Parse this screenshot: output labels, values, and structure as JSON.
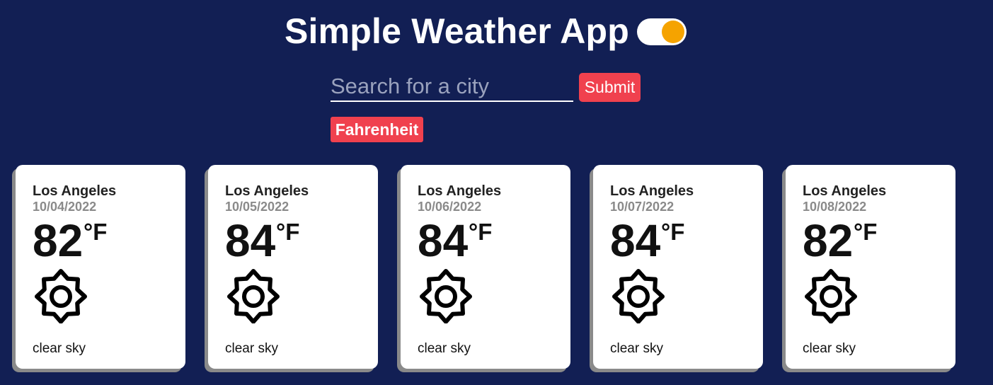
{
  "header": {
    "title": "Simple Weather App"
  },
  "search": {
    "placeholder": "Search for a city",
    "value": "",
    "submit_label": "Submit"
  },
  "units": {
    "button_label": "Fahrenheit"
  },
  "colors": {
    "background": "#121f54",
    "accent": "#f0414e",
    "toggle_knob": "#f5a300"
  },
  "forecast": [
    {
      "city": "Los Angeles",
      "date": "10/04/2022",
      "temp": "82",
      "unit": "°F",
      "icon": "sun-icon",
      "description": "clear sky"
    },
    {
      "city": "Los Angeles",
      "date": "10/05/2022",
      "temp": "84",
      "unit": "°F",
      "icon": "sun-icon",
      "description": "clear sky"
    },
    {
      "city": "Los Angeles",
      "date": "10/06/2022",
      "temp": "84",
      "unit": "°F",
      "icon": "sun-icon",
      "description": "clear sky"
    },
    {
      "city": "Los Angeles",
      "date": "10/07/2022",
      "temp": "84",
      "unit": "°F",
      "icon": "sun-icon",
      "description": "clear sky"
    },
    {
      "city": "Los Angeles",
      "date": "10/08/2022",
      "temp": "82",
      "unit": "°F",
      "icon": "sun-icon",
      "description": "clear sky"
    }
  ]
}
